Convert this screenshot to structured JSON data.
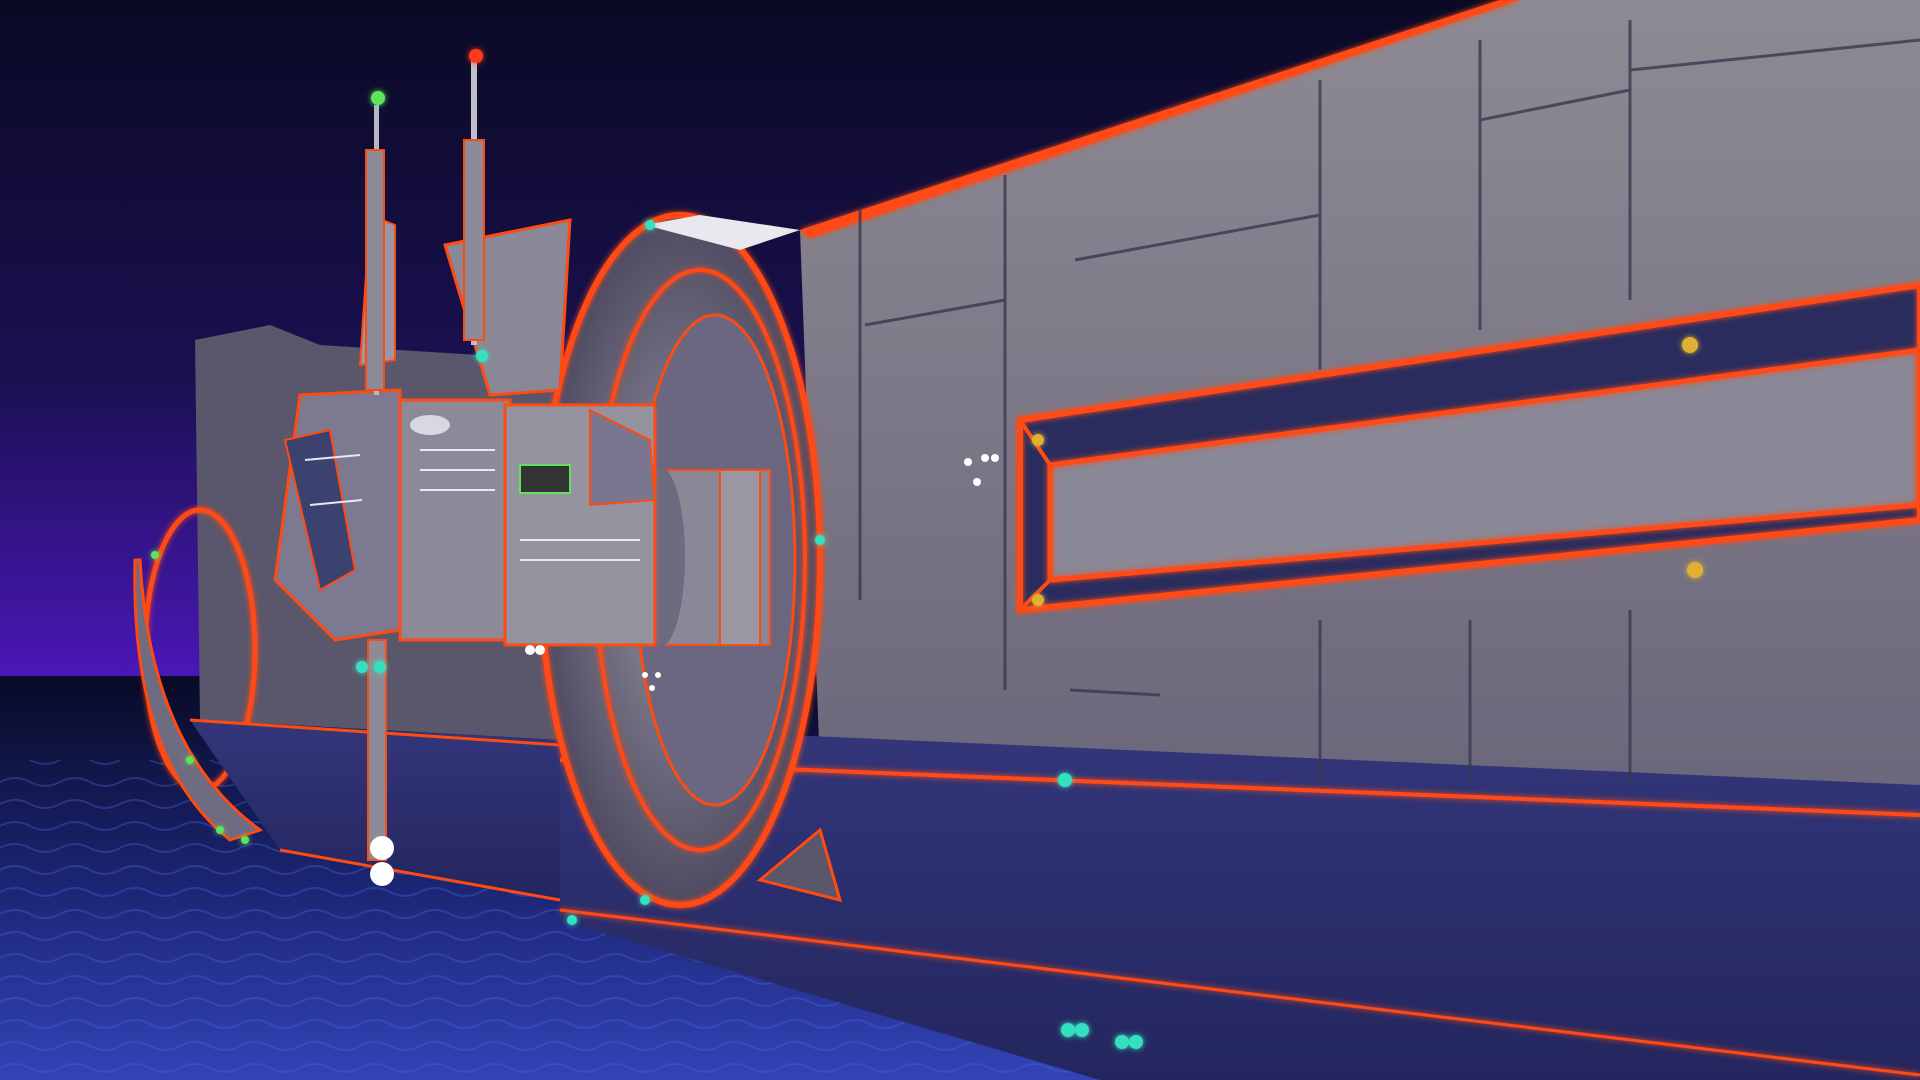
{
  "scene": {
    "subject": "sci-fi-space-station-render",
    "palette": {
      "sky_top": "#0a0a24",
      "sky_horizon": "#4a17b8",
      "ground_dark": "#0b0f3a",
      "ground_mid": "#2b3aa0",
      "hull_light": "#8b8792",
      "hull_dark": "#5b5770",
      "hull_shadow": "#2f3168",
      "neon_orange": "#ff4a12",
      "light_green": "#5fe35a",
      "light_red": "#ff3a1a",
      "light_cyan": "#36e0c0",
      "light_yellow": "#e0b030",
      "light_white": "#ffffff"
    },
    "icons": [
      "antenna-icon",
      "beacon-light-icon",
      "porthole-icon"
    ]
  }
}
